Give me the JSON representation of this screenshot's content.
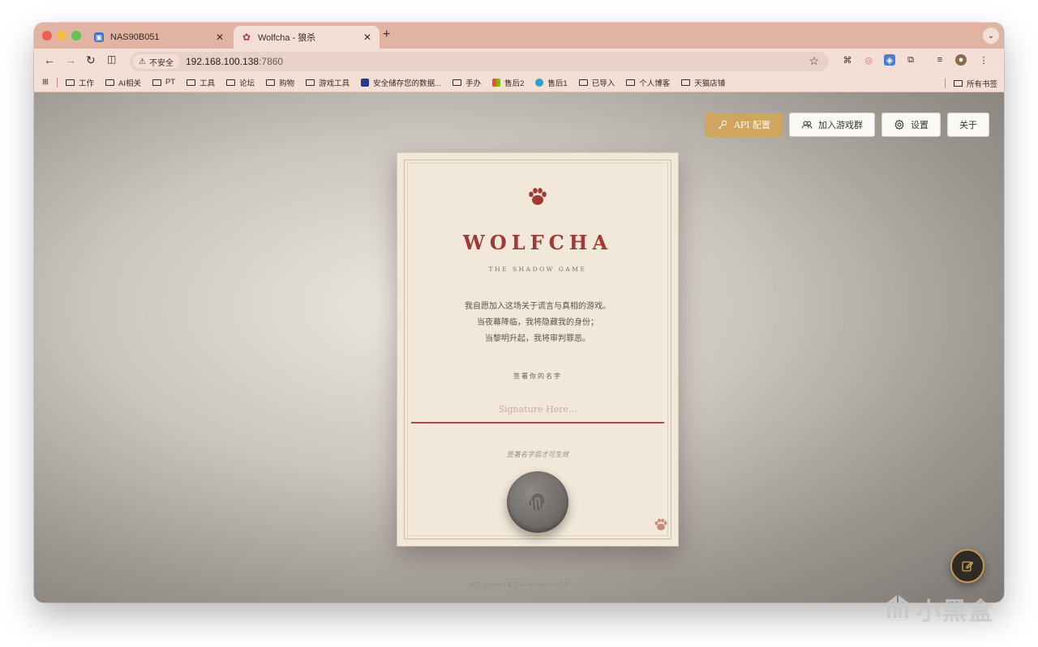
{
  "browser": {
    "tabs": [
      {
        "label": "NAS90B051",
        "favicon": "nas-icon"
      },
      {
        "label": "Wolfcha - 狼杀",
        "favicon": "paw-icon"
      }
    ],
    "url_host": "192.168.100.138",
    "url_port": ":7860",
    "security_label": "不安全",
    "bookmarks": [
      "工作",
      "AI相关",
      "PT",
      "工具",
      "论坛",
      "购物",
      "游戏工具",
      "安全储存您的数据...",
      "手办",
      "售后2",
      "售后1",
      "已导入",
      "个人博客",
      "天猫店铺"
    ],
    "all_bookmarks": "所有书签",
    "colors": {
      "tabstrip": "#e0b3a3",
      "toolbar": "#f4dfd6"
    }
  },
  "page": {
    "buttons": {
      "api": "API 配置",
      "join": "加入游戏群",
      "settings": "设置",
      "about": "关于"
    },
    "card": {
      "title": "WOLFCHA",
      "subtitle": "THE SHADOW GAME",
      "oath_1": "我自愿加入这场关于谎言与真相的游戏。",
      "oath_2": "当夜幕降临，我将隐藏我的身份；",
      "oath_3": "当黎明升起，我将审判罪恶。",
      "sign_label": "签署你的名字",
      "sign_placeholder": "Signature Here...",
      "sign_hint": "签署名字后才可生效"
    },
    "footer": "MIT License | 基于 oil-oil/wolfcha 二开",
    "colors": {
      "accent": "#a13a34",
      "gold": "#cfa560"
    }
  },
  "watermark": "小黑盒"
}
